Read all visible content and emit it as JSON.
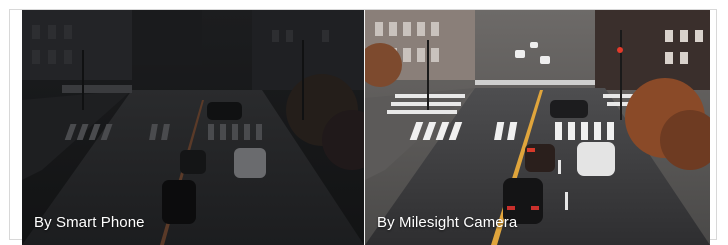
{
  "comparison": {
    "left_caption": "By Smart Phone",
    "right_caption": "By Milesight Camera"
  }
}
